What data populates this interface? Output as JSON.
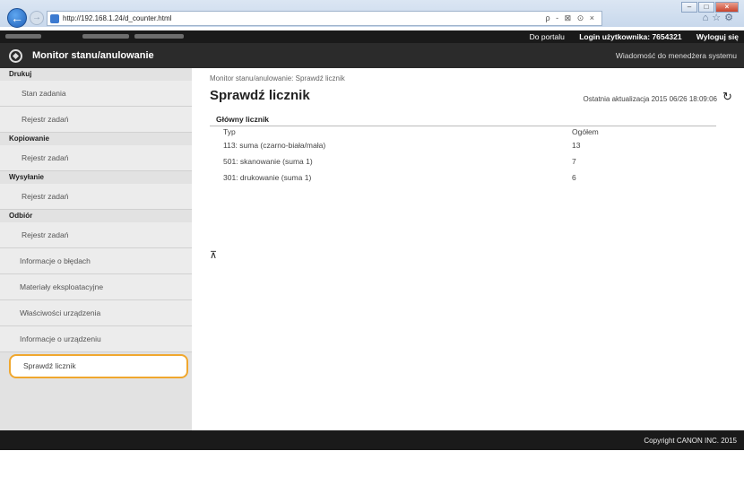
{
  "browser": {
    "url": "http://192.168.1.24/d_counter.html",
    "address_tools": "ρ - ⊠ ⊙ ×"
  },
  "topbar": {
    "portal_link": "Do portalu",
    "login_label": "Login użytkownika:",
    "login_value": "7654321",
    "logout_link": "Wyloguj się"
  },
  "header": {
    "title": "Monitor stanu/anulowanie",
    "admin_message_link": "Wiadomość do menedżera systemu"
  },
  "sidebar": {
    "sections": [
      {
        "heading": "Drukuj",
        "items": [
          "Stan zadania",
          "Rejestr zadań"
        ]
      },
      {
        "heading": "Kopiowanie",
        "items": [
          "Rejestr zadań"
        ]
      },
      {
        "heading": "Wysyłanie",
        "items": [
          "Rejestr zadań"
        ]
      },
      {
        "heading": "Odbiór",
        "items": [
          "Rejestr zadań"
        ]
      }
    ],
    "extra_items": [
      "Informacje o błędach",
      "Materiały eksploatacyjne",
      "Właściwości urządzenia",
      "Informacje o urządzeniu"
    ],
    "active_item": "Sprawdź licznik"
  },
  "main": {
    "breadcrumb": "Monitor stanu/anulowanie: Sprawdź licznik",
    "title": "Sprawdź licznik",
    "last_update": "Ostatnia aktualizacja 2015 06/26 18:09:06",
    "section_title": "Główny licznik",
    "columns": [
      "Typ",
      "Ogółem"
    ],
    "rows": [
      [
        "113: suma (czarno-biała/mała)",
        "13"
      ],
      [
        "501: skanowanie (suma 1)",
        "7"
      ],
      [
        "301: drukowanie (suma 1)",
        "6"
      ]
    ],
    "jump_top_icon": "arrow-up-bar-icon"
  },
  "footer": {
    "copyright": "Copyright CANON INC. 2015"
  }
}
